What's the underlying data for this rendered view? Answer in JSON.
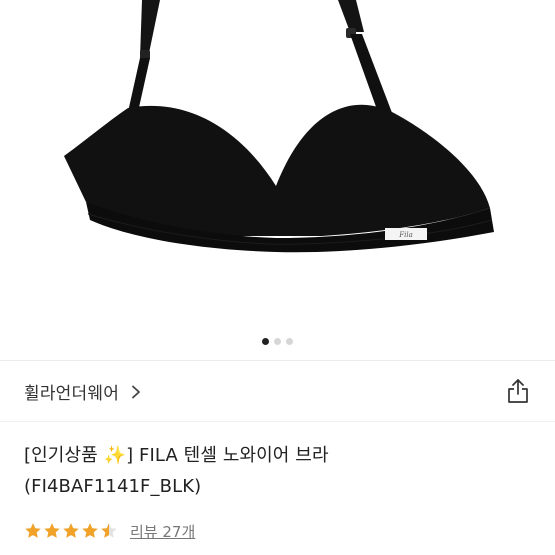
{
  "product": {
    "brand": "휠라언더웨어",
    "title_line1": "[인기상품 ✨] FILA 텐셀 노와이어 브라",
    "title_line2": "(FI4BAF1141F_BLK)",
    "rating": 4.5,
    "rating_max": 5,
    "review_label": "리뷰 27개",
    "image_logo": "Fila"
  },
  "carousel": {
    "count": 3,
    "active_index": 0
  },
  "icons": {
    "brand_chevron": "chevron-right-icon",
    "share": "share-icon",
    "star": "star-icon"
  },
  "colors": {
    "star": "#f0a229",
    "garment": "#111111",
    "active_dot": "#222222",
    "inactive_dot": "#d6d6d6"
  }
}
